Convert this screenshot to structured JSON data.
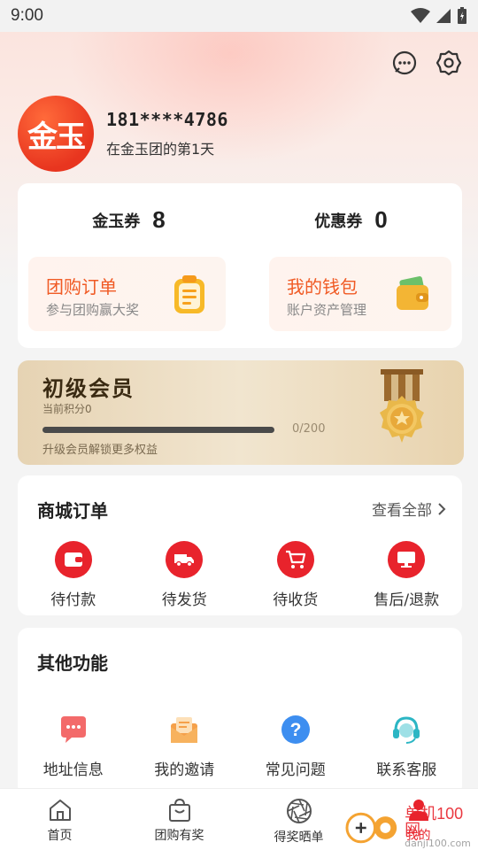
{
  "status_bar": {
    "time": "9:00"
  },
  "header": {
    "icons": [
      "message-icon",
      "settings-icon"
    ]
  },
  "profile": {
    "avatar_text": "金玉",
    "phone": "181****4786",
    "days_text": "在金玉团的第1天"
  },
  "assets": {
    "coupon_gold": {
      "label": "金玉券",
      "value": "8"
    },
    "coupon_discount": {
      "label": "优惠券",
      "value": "0"
    },
    "group_order": {
      "title": "团购订单",
      "subtitle": "参与团购赢大奖"
    },
    "wallet": {
      "title": "我的钱包",
      "subtitle": "账户资产管理"
    }
  },
  "member": {
    "level": "初级会员",
    "points_text": "当前积分0",
    "progress_text": "0/200",
    "progress": 0,
    "hint": "升级会员解锁更多权益"
  },
  "orders": {
    "title": "商城订单",
    "view_all": "查看全部",
    "items": [
      {
        "label": "待付款",
        "icon": "wallet-icon"
      },
      {
        "label": "待发货",
        "icon": "truck-icon"
      },
      {
        "label": "待收货",
        "icon": "cart-icon"
      },
      {
        "label": "售后/退款",
        "icon": "monitor-icon"
      }
    ]
  },
  "other": {
    "title": "其他功能",
    "items": [
      {
        "label": "地址信息",
        "icon": "chat-bubble-icon"
      },
      {
        "label": "我的邀请",
        "icon": "envelope-icon"
      },
      {
        "label": "常见问题",
        "icon": "question-icon"
      },
      {
        "label": "联系客服",
        "icon": "headset-icon"
      }
    ]
  },
  "nav": {
    "items": [
      {
        "label": "首页",
        "icon": "home-icon"
      },
      {
        "label": "团购有奖",
        "icon": "shopping-bag-icon"
      },
      {
        "label": "得奖晒单",
        "icon": "aperture-icon"
      },
      {
        "label": "我的",
        "icon": "user-icon"
      }
    ]
  },
  "watermark": {
    "brand": "单机100网",
    "url": "danji100.com"
  },
  "colors": {
    "accent": "#e8232c",
    "orange": "#f05a24"
  }
}
